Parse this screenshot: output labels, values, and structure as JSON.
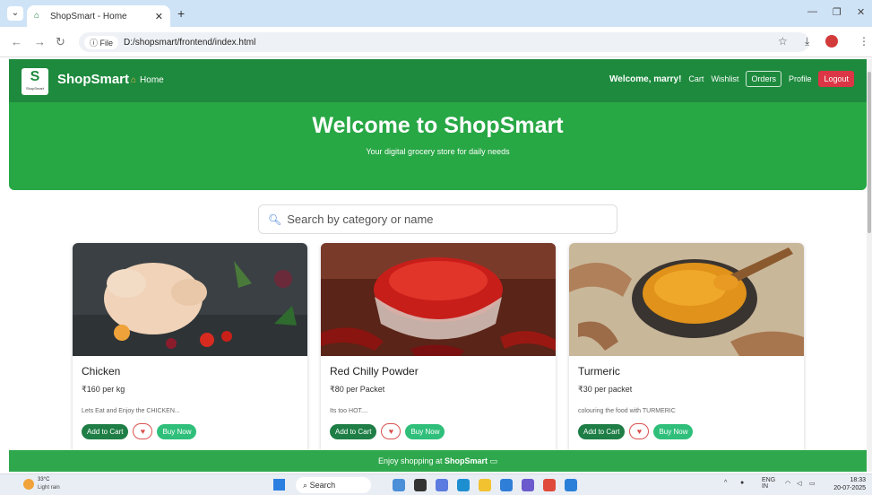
{
  "browser": {
    "tab_title": "ShopSmart - Home",
    "new_tab": "+",
    "file_chip": "File",
    "url": "D:/shopsmart/frontend/index.html"
  },
  "navbar": {
    "logo_letter": "S",
    "logo_sub": "ShopSmart",
    "brand": "ShopSmart",
    "home_label": "Home",
    "welcome": "Welcome, marry!",
    "links": [
      "Cart",
      "Wishlist"
    ],
    "orders": "Orders",
    "profile": "Profile",
    "logout": "Logout"
  },
  "hero": {
    "title": "Welcome to ShopSmart",
    "subtitle": "Your digital grocery store for daily needs"
  },
  "search": {
    "placeholder": "Search by category or name"
  },
  "products": [
    {
      "name": "Chicken",
      "price": "₹160 per kg",
      "desc": "Lets Eat and Enjoy the CHICKEN..."
    },
    {
      "name": "Red Chilly Powder",
      "price": "₹80 per Packet",
      "desc": "Its too HOT...."
    },
    {
      "name": "Turmeric",
      "price": "₹30 per packet",
      "desc": "colouring the food with TURMERIC"
    }
  ],
  "card_buttons": {
    "add_to_cart": "Add to Cart",
    "wishlist": "♥",
    "buy_now": "Buy Now"
  },
  "footer": {
    "prefix": "Enjoy shopping at ",
    "brand": "ShopSmart"
  },
  "taskbar": {
    "weather_temp": "33°C",
    "weather_desc": "Light rain",
    "search": "Search",
    "lang": "ENG",
    "region": "IN",
    "time": "18:33",
    "date": "20-07-2025"
  },
  "colors": {
    "navbar": "#1e8a3e",
    "hero": "#28a745",
    "logout": "#dc3545",
    "add_to_cart": "#1e7e45",
    "buy_now": "#2fbf7a",
    "footer": "#2fa84d"
  }
}
